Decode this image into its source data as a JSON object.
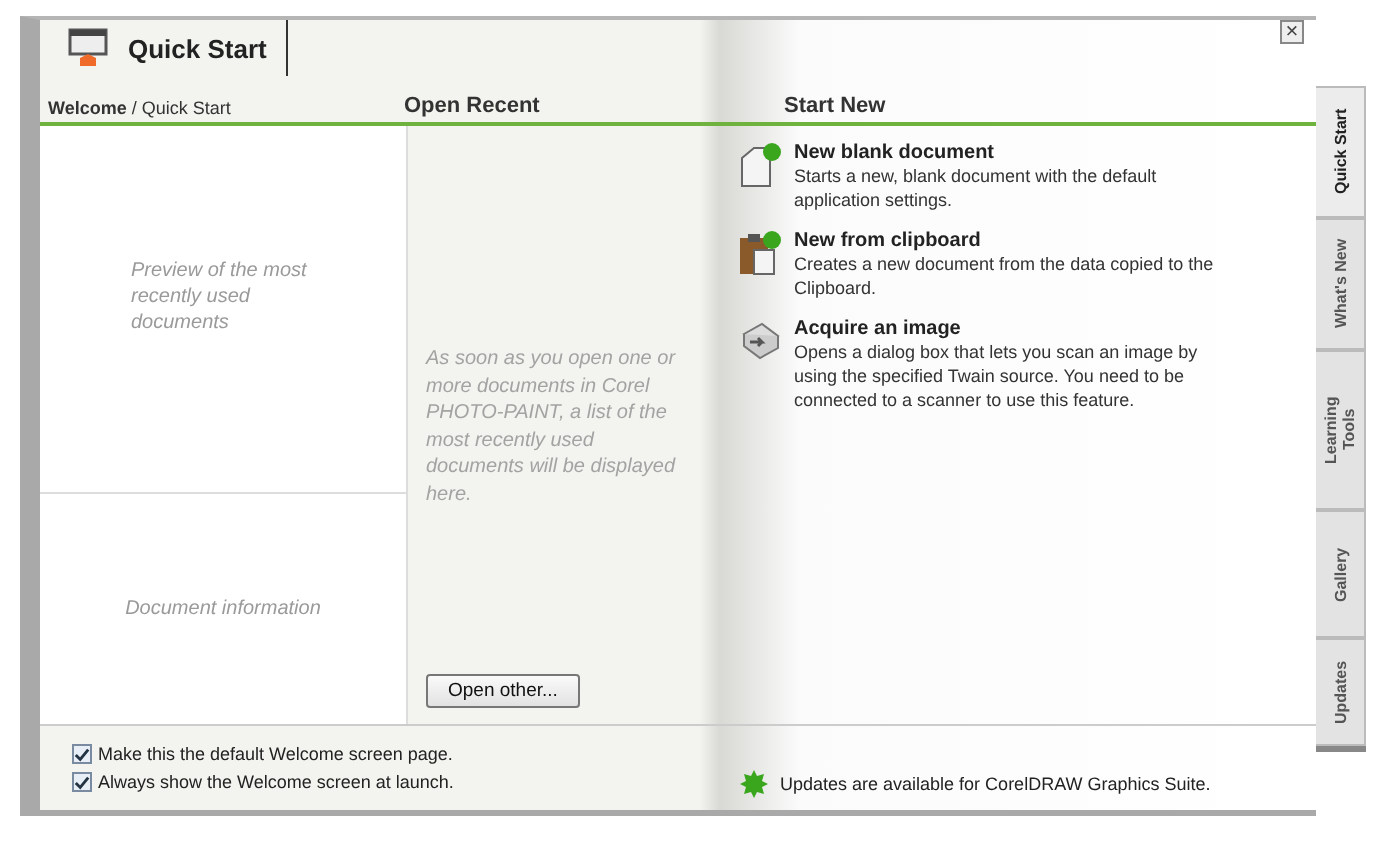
{
  "header": {
    "tab": "Quick Start",
    "close": "×"
  },
  "columns": {
    "breadcrumb": "**Welcome** / Quick Start",
    "open_recent": "Open Recent",
    "start_new": "Start New"
  },
  "preview": {
    "caption": "Preview of the most recently used documents"
  },
  "document_info": {
    "caption": "Document information"
  },
  "recent": {
    "message": "As soon as you open one or more documents in Corel PHOTO-PAINT, a list of the most recently used documents will be displayed here.",
    "button": "Open other..."
  },
  "start_items": [
    {
      "kind": "blank",
      "title": "New blank document",
      "description": "Starts a new, blank document with the default application settings."
    },
    {
      "kind": "clipboard",
      "title": "New from clipboard",
      "description": "Creates a new document from the data copied to the Clipboard."
    },
    {
      "kind": "acquire",
      "title": "Acquire an image",
      "description": "Opens a dialog box that lets you scan an image by using the specified Twain source. You need to be connected to a scanner to use this feature."
    }
  ],
  "options": [
    {
      "label": "Make this the default Welcome screen page.",
      "checked": true
    },
    {
      "label": "Always show the Welcome screen at launch.",
      "checked": true
    }
  ],
  "update_notice": "Updates are available for CorelDRAW Graphics Suite.",
  "side_tabs": [
    {
      "label": "Quick Start",
      "selected": true
    },
    {
      "label": "What's New",
      "selected": false
    },
    {
      "label": "Learning Tools",
      "selected": false
    },
    {
      "label": "Gallery",
      "selected": false
    },
    {
      "label": "Updates",
      "selected": false
    }
  ]
}
